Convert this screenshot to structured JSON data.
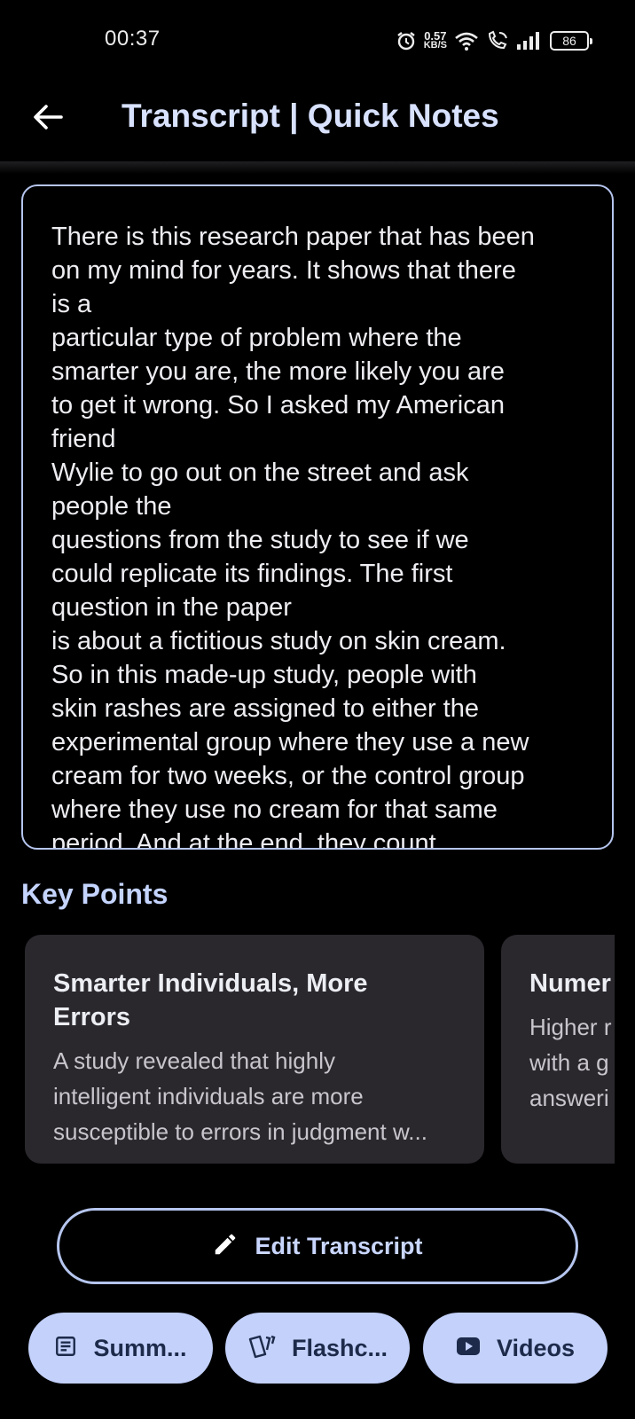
{
  "status_bar": {
    "time": "00:37",
    "net_speed_value": "0.57",
    "net_speed_unit": "KB/S",
    "battery": "86",
    "icons": [
      "alarm-icon",
      "wifi-icon",
      "wifi-calling-icon",
      "signal-icon",
      "battery-icon"
    ]
  },
  "app_bar": {
    "title": "Transcript | Quick Notes",
    "back_icon": "arrow-left-icon"
  },
  "transcript": {
    "text": "There is this research paper that has been\non my mind for years. It shows that there\nis a\nparticular type of problem where the\nsmarter you are, the more likely you are\nto get it wrong. So I asked my American\nfriend\nWylie to go out on the street and ask\npeople the\nquestions from the study to see if we\ncould replicate its findings. The first\nquestion in the paper\nis about a fictitious study on skin cream.\nSo in this made-up study, people with\nskin rashes are assigned to either the\nexperimental group where they use a new\ncream for two weeks, or the control group\nwhere they use no cream for that same\nperiod. And at the end, they count"
  },
  "key_points": {
    "title": "Key Points",
    "cards": [
      {
        "title": "Smarter Individuals, More\nErrors",
        "description": "A study revealed that highly\nintelligent individuals are more\nsusceptible to errors in judgment w..."
      },
      {
        "title": "Numer",
        "description": "Higher r\nwith a g\nansweri"
      }
    ]
  },
  "actions": {
    "edit_label": "Edit Transcript",
    "edit_icon": "pencil-icon",
    "pills": [
      {
        "label": "Summ...",
        "icon": "document-icon"
      },
      {
        "label": "Flashc...",
        "icon": "flashcards-icon"
      },
      {
        "label": "Videos",
        "icon": "youtube-icon"
      }
    ]
  },
  "colors": {
    "background": "#000000",
    "accent": "#c4d4ff",
    "outline": "#b5c5ee",
    "card": "#2a282d",
    "pill": "#c3d1fb"
  }
}
